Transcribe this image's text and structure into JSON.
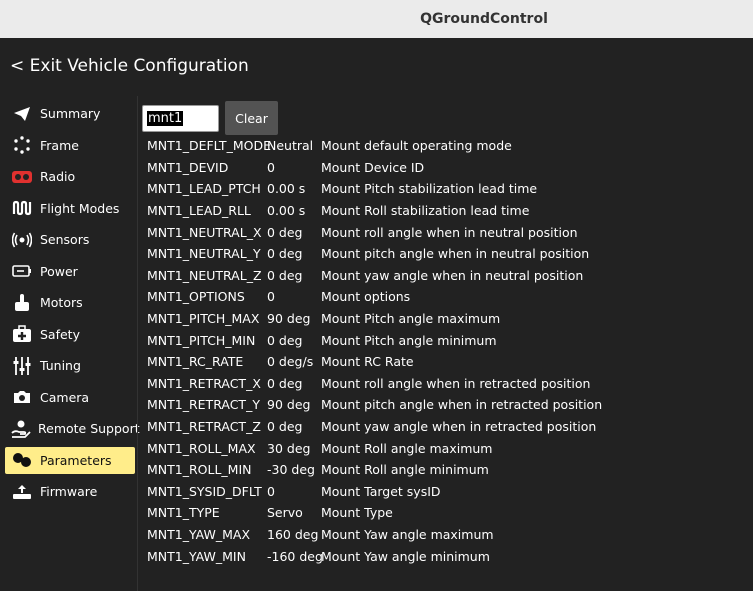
{
  "titlebar": {
    "title": "QGroundControl"
  },
  "header": {
    "exit_label": "< Exit Vehicle Configuration"
  },
  "sidebar": {
    "items": [
      {
        "label": "Summary",
        "icon": "paper-plane-icon"
      },
      {
        "label": "Frame",
        "icon": "frame-dots-icon"
      },
      {
        "label": "Radio",
        "icon": "radio-icon"
      },
      {
        "label": "Flight Modes",
        "icon": "flight-modes-icon"
      },
      {
        "label": "Sensors",
        "icon": "sensors-icon"
      },
      {
        "label": "Power",
        "icon": "battery-icon"
      },
      {
        "label": "Motors",
        "icon": "motor-icon"
      },
      {
        "label": "Safety",
        "icon": "first-aid-icon"
      },
      {
        "label": "Tuning",
        "icon": "sliders-icon"
      },
      {
        "label": "Camera",
        "icon": "camera-icon"
      },
      {
        "label": "Remote Support",
        "icon": "remote-support-icon"
      },
      {
        "label": "Parameters",
        "icon": "parameters-icon",
        "active": true
      },
      {
        "label": "Firmware",
        "icon": "firmware-icon"
      }
    ],
    "active_color": "#ffed8a"
  },
  "search": {
    "value": "mnt1",
    "clear_label": "Clear"
  },
  "params": [
    {
      "name": "MNT1_DEFLT_MODE",
      "value": "Neutral",
      "desc": "Mount default operating mode"
    },
    {
      "name": "MNT1_DEVID",
      "value": "0",
      "desc": "Mount Device ID"
    },
    {
      "name": "MNT1_LEAD_PTCH",
      "value": "0.00 s",
      "desc": "Mount Pitch stabilization lead time"
    },
    {
      "name": "MNT1_LEAD_RLL",
      "value": "0.00 s",
      "desc": "Mount Roll stabilization lead time"
    },
    {
      "name": "MNT1_NEUTRAL_X",
      "value": "0 deg",
      "desc": "Mount roll angle when in neutral position"
    },
    {
      "name": "MNT1_NEUTRAL_Y",
      "value": "0 deg",
      "desc": "Mount pitch angle when in neutral position"
    },
    {
      "name": "MNT1_NEUTRAL_Z",
      "value": "0 deg",
      "desc": "Mount yaw angle when in neutral position"
    },
    {
      "name": "MNT1_OPTIONS",
      "value": "0",
      "desc": "Mount options"
    },
    {
      "name": "MNT1_PITCH_MAX",
      "value": "90 deg",
      "desc": "Mount Pitch angle maximum"
    },
    {
      "name": "MNT1_PITCH_MIN",
      "value": "0 deg",
      "desc": "Mount Pitch angle minimum"
    },
    {
      "name": "MNT1_RC_RATE",
      "value": "0 deg/s",
      "desc": "Mount RC Rate"
    },
    {
      "name": "MNT1_RETRACT_X",
      "value": "0 deg",
      "desc": "Mount roll angle when in retracted position"
    },
    {
      "name": "MNT1_RETRACT_Y",
      "value": "90 deg",
      "desc": "Mount pitch angle when in retracted position"
    },
    {
      "name": "MNT1_RETRACT_Z",
      "value": "0 deg",
      "desc": "Mount yaw angle when in retracted position"
    },
    {
      "name": "MNT1_ROLL_MAX",
      "value": "30 deg",
      "desc": "Mount Roll angle maximum"
    },
    {
      "name": "MNT1_ROLL_MIN",
      "value": "-30 deg",
      "desc": "Mount Roll angle minimum"
    },
    {
      "name": "MNT1_SYSID_DFLT",
      "value": "0",
      "desc": "Mount Target sysID"
    },
    {
      "name": "MNT1_TYPE",
      "value": "Servo",
      "desc": "Mount Type"
    },
    {
      "name": "MNT1_YAW_MAX",
      "value": "160 deg",
      "desc": "Mount Yaw angle maximum"
    },
    {
      "name": "MNT1_YAW_MIN",
      "value": "-160 deg",
      "desc": "Mount Yaw angle minimum"
    }
  ]
}
